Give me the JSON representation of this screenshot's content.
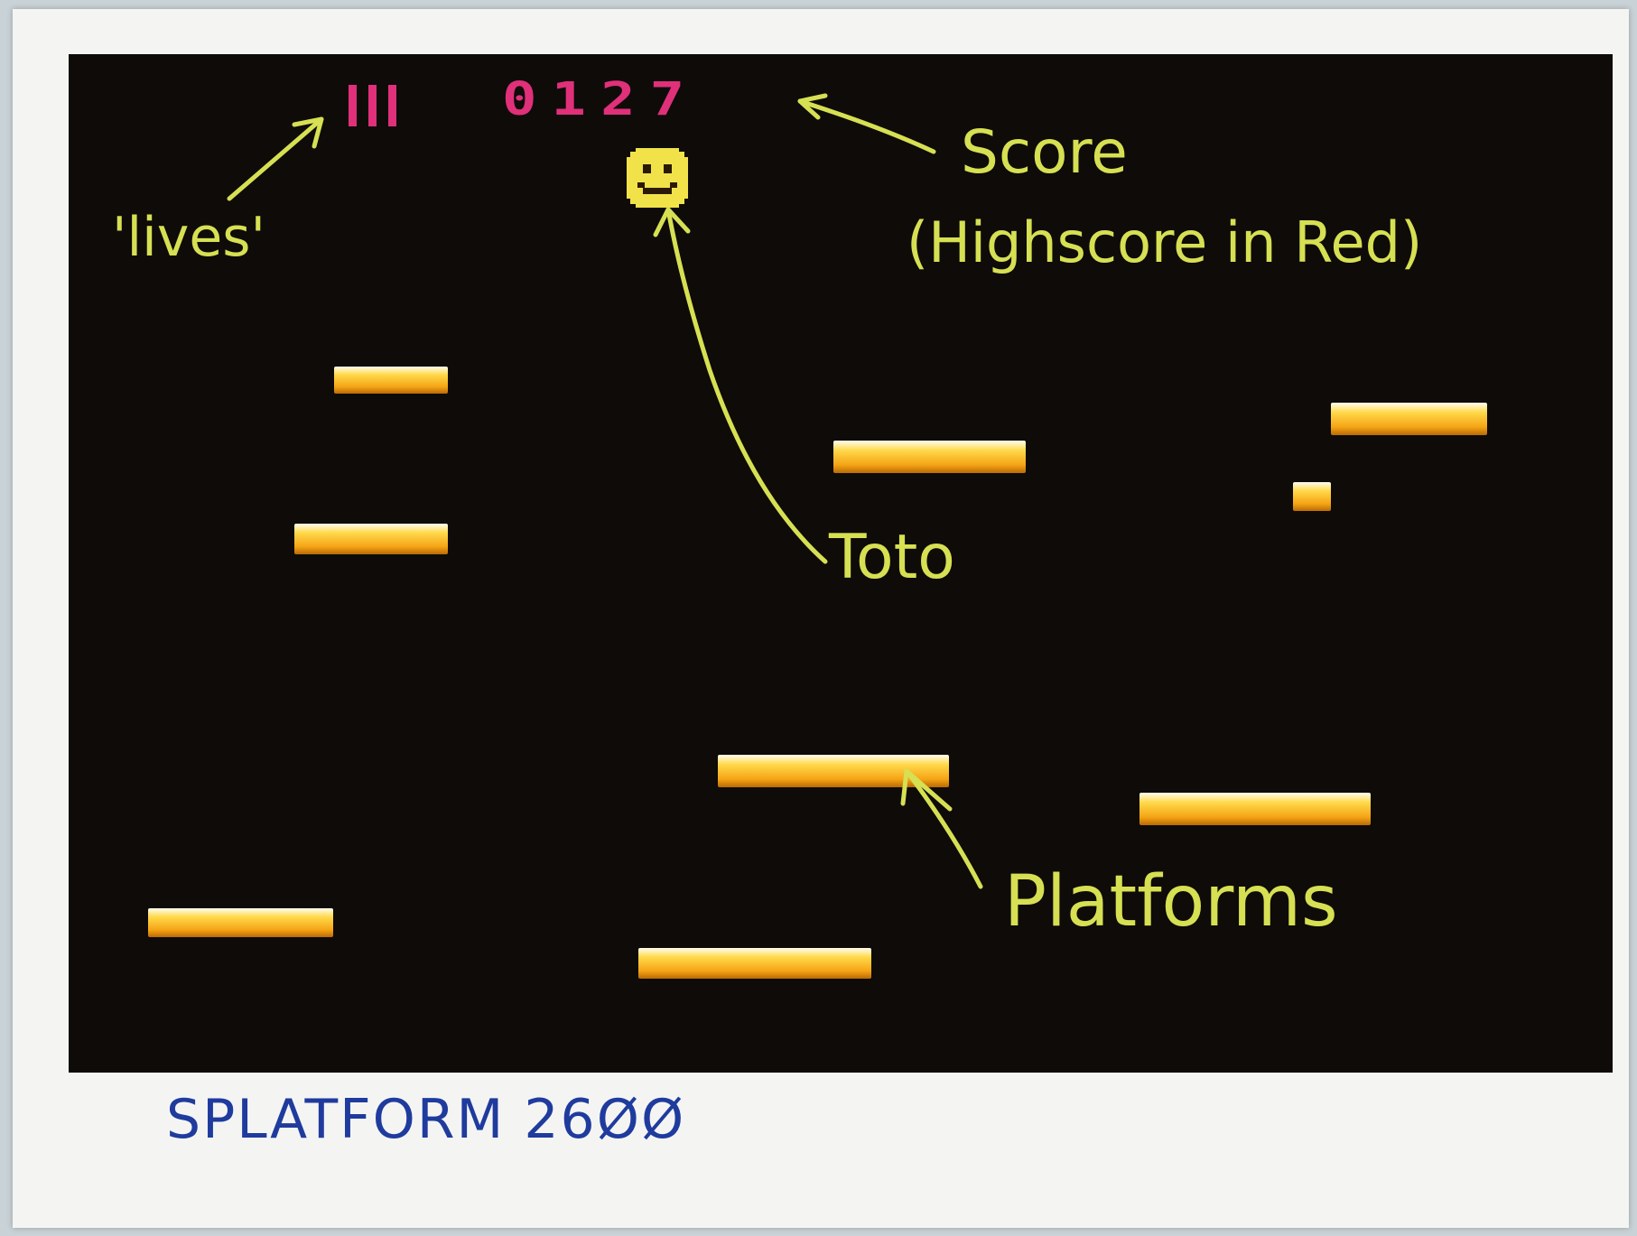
{
  "hud": {
    "lives_count": 3,
    "score": "0127",
    "score_color": "#e0307a"
  },
  "player": {
    "name": "Toto",
    "icon": "smiley-face-icon",
    "color": "#f2e24a"
  },
  "platform_color": "#f5a415",
  "annotations": {
    "lives": "'lives'",
    "score": "Score",
    "highscore": "(Highscore in Red)",
    "toto": "Toto",
    "platforms": "Platforms"
  },
  "caption": "SPLATFORM 26ØØ"
}
